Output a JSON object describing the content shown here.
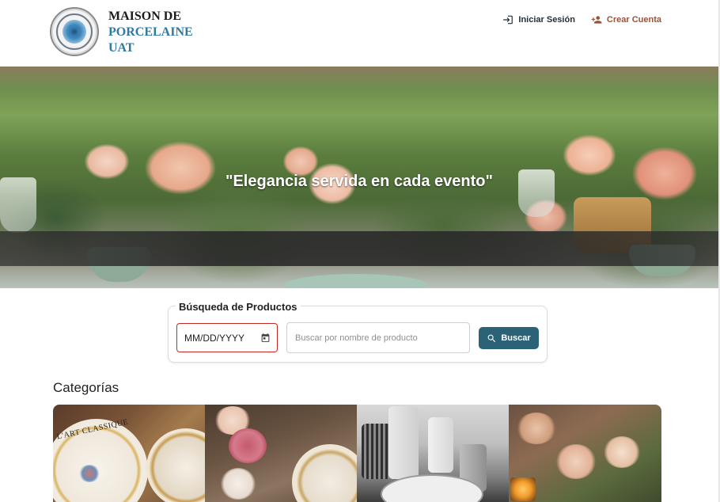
{
  "brand": {
    "line1": "MAISON DE",
    "line2": "PORCELAINE",
    "line3": "UAT"
  },
  "nav": {
    "login_label": "Iniciar Sesión",
    "signup_label": "Crear Cuenta"
  },
  "hero": {
    "tagline": "\"Elegancia servida en cada evento\""
  },
  "search": {
    "legend": "Búsqueda de Productos",
    "date_value": "MM/DD/YYYY",
    "name_placeholder": "Buscar por nombre de producto",
    "button_label": "Buscar"
  },
  "categories": {
    "title": "Categorías",
    "tile1_text": "L'ART CLASSIQUE"
  },
  "colors": {
    "accent": "#2c6277",
    "brand_blue": "#2f7a9e",
    "signup": "#9a5337",
    "error_border": "#c62828"
  },
  "icons": {
    "login": "login-icon",
    "signup": "person-add-icon",
    "calendar": "calendar-icon",
    "search": "search-icon"
  }
}
